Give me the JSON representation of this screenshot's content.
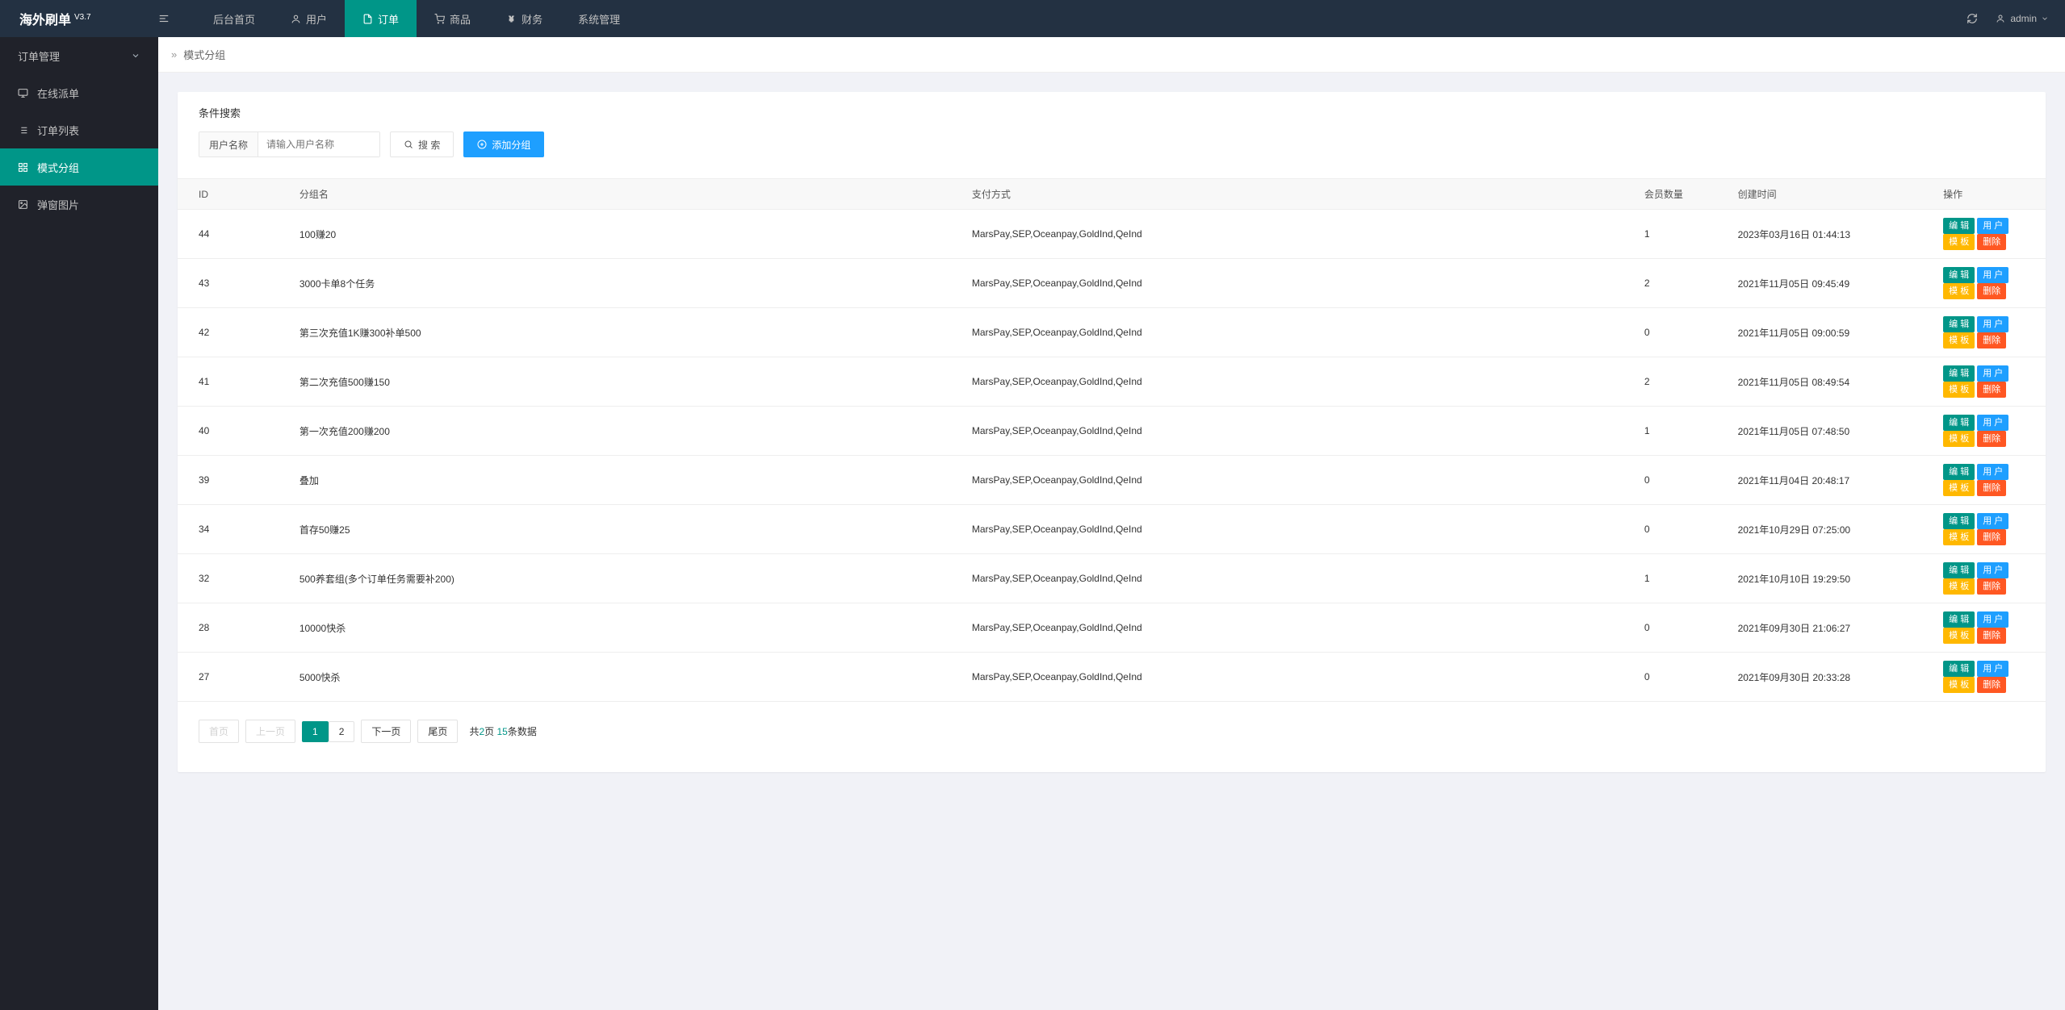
{
  "app": {
    "name": "海外刷单",
    "version": "V3.7"
  },
  "topnav": [
    {
      "label": "后台首页",
      "icon": null
    },
    {
      "label": "用户",
      "icon": "user"
    },
    {
      "label": "订单",
      "icon": "doc",
      "active": true
    },
    {
      "label": "商品",
      "icon": "cart"
    },
    {
      "label": "财务",
      "icon": "yen"
    },
    {
      "label": "系统管理",
      "icon": null
    }
  ],
  "headerRight": {
    "user": "admin"
  },
  "sidebar": {
    "group": "订单管理",
    "items": [
      {
        "label": "在线派单",
        "icon": "monitor"
      },
      {
        "label": "订单列表",
        "icon": "list"
      },
      {
        "label": "模式分组",
        "icon": "grid",
        "active": true
      },
      {
        "label": "弹窗图片",
        "icon": "image"
      }
    ]
  },
  "breadcrumb": "模式分组",
  "search": {
    "title": "条件搜索",
    "userLabel": "用户名称",
    "userPlaceholder": "请输入用户名称",
    "searchBtn": "搜 索",
    "addBtn": "添加分组"
  },
  "table": {
    "headers": [
      "ID",
      "分组名",
      "支付方式",
      "会员数量",
      "创建时间",
      "操作"
    ],
    "actions": {
      "edit": "编 辑",
      "user": "用 户",
      "template": "模 板",
      "delete": "删除"
    },
    "rows": [
      {
        "id": "44",
        "name": "100赚20",
        "pay": "MarsPay,SEP,Oceanpay,GoldInd,QeInd",
        "members": "1",
        "created": "2023年03月16日 01:44:13"
      },
      {
        "id": "43",
        "name": "3000卡单8个任务",
        "pay": "MarsPay,SEP,Oceanpay,GoldInd,QeInd",
        "members": "2",
        "created": "2021年11月05日 09:45:49"
      },
      {
        "id": "42",
        "name": "第三次充值1K赚300补单500",
        "pay": "MarsPay,SEP,Oceanpay,GoldInd,QeInd",
        "members": "0",
        "created": "2021年11月05日 09:00:59"
      },
      {
        "id": "41",
        "name": "第二次充值500赚150",
        "pay": "MarsPay,SEP,Oceanpay,GoldInd,QeInd",
        "members": "2",
        "created": "2021年11月05日 08:49:54"
      },
      {
        "id": "40",
        "name": "第一次充值200赚200",
        "pay": "MarsPay,SEP,Oceanpay,GoldInd,QeInd",
        "members": "1",
        "created": "2021年11月05日 07:48:50"
      },
      {
        "id": "39",
        "name": "叠加",
        "pay": "MarsPay,SEP,Oceanpay,GoldInd,QeInd",
        "members": "0",
        "created": "2021年11月04日 20:48:17"
      },
      {
        "id": "34",
        "name": "首存50赚25",
        "pay": "MarsPay,SEP,Oceanpay,GoldInd,QeInd",
        "members": "0",
        "created": "2021年10月29日 07:25:00"
      },
      {
        "id": "32",
        "name": "500养套组(多个订单任务需要补200)",
        "pay": "MarsPay,SEP,Oceanpay,GoldInd,QeInd",
        "members": "1",
        "created": "2021年10月10日 19:29:50"
      },
      {
        "id": "28",
        "name": "10000快杀",
        "pay": "MarsPay,SEP,Oceanpay,GoldInd,QeInd",
        "members": "0",
        "created": "2021年09月30日 21:06:27"
      },
      {
        "id": "27",
        "name": "5000快杀",
        "pay": "MarsPay,SEP,Oceanpay,GoldInd,QeInd",
        "members": "0",
        "created": "2021年09月30日 20:33:28"
      }
    ]
  },
  "pager": {
    "first": "首页",
    "prev": "上一页",
    "next": "下一页",
    "last": "尾页",
    "pages": [
      "1",
      "2"
    ],
    "current": "1",
    "info_pre": "共",
    "totalPages": "2",
    "info_mid": "页 ",
    "totalRecords": "15",
    "info_post": "条数据"
  }
}
